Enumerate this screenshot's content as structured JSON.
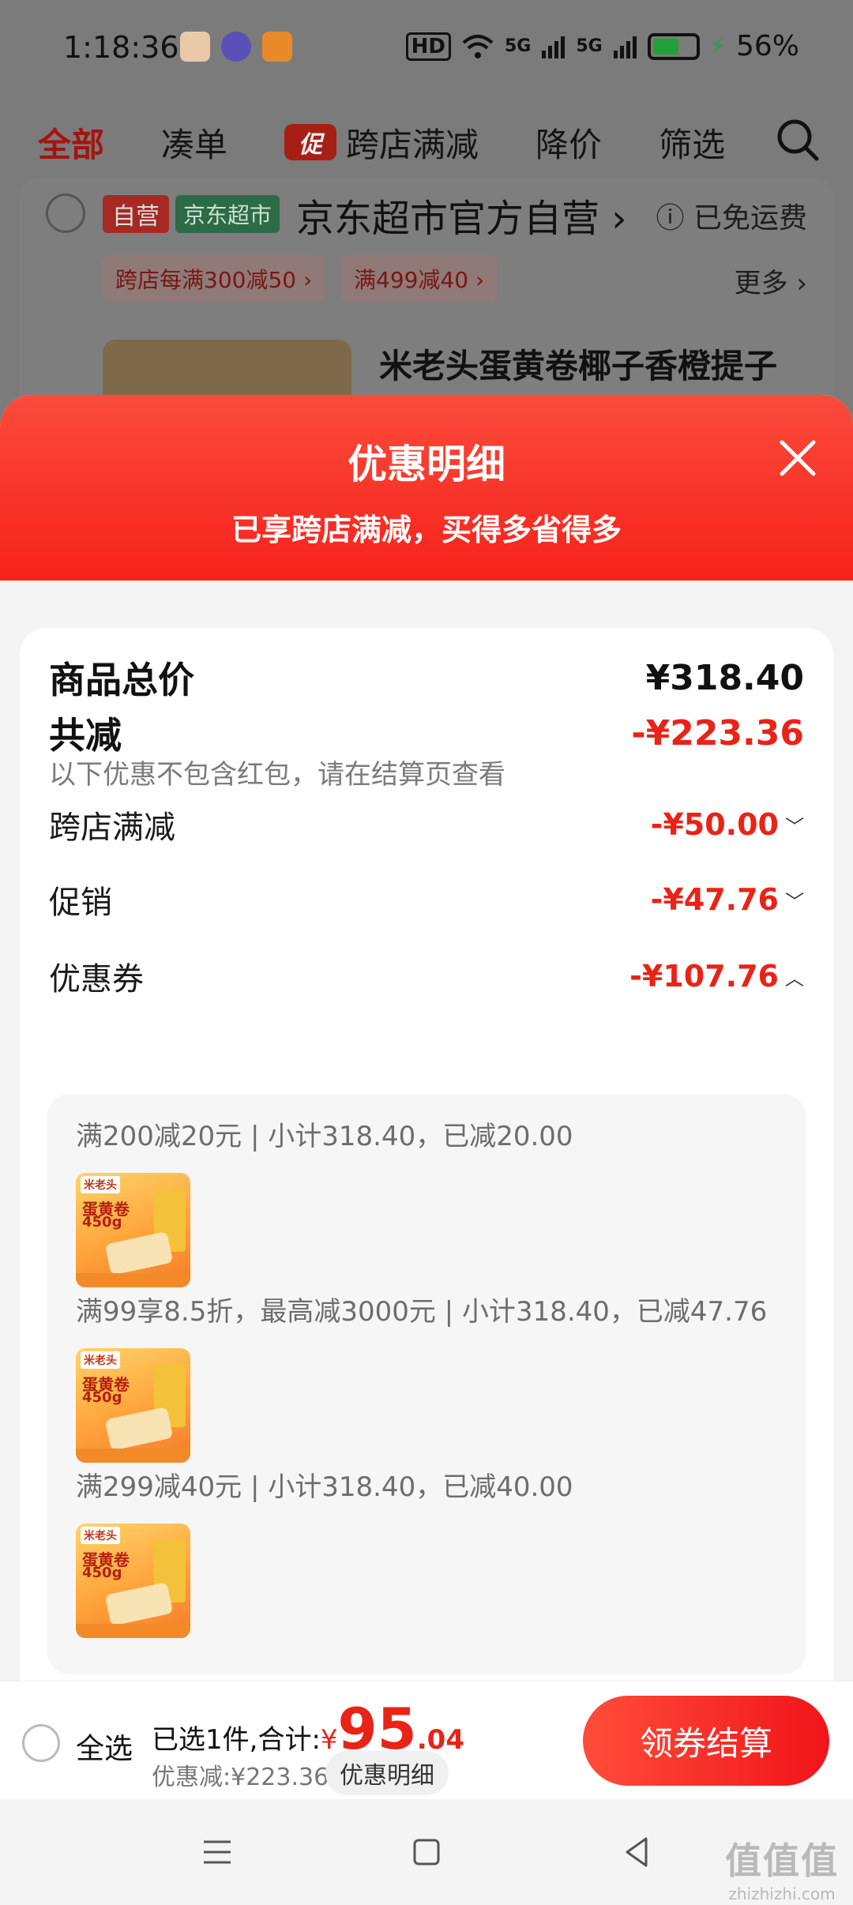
{
  "status_bar": {
    "time": "1:18:36",
    "hd_label": "HD",
    "net1": "5G",
    "net2": "5G",
    "battery": "56%"
  },
  "top_tabs": {
    "all": "全部",
    "combine": "凑单",
    "promo_badge": "促",
    "cross_store": "跨店满减",
    "price_drop": "降价",
    "filter": "筛选"
  },
  "store": {
    "tag_self": "自营",
    "tag_jd": "京东超市",
    "name": "京东超市官方自营",
    "shipping": "已免运费",
    "chip1": "跨店每满300减50",
    "chip2": "满499减40",
    "more": "更多"
  },
  "product": {
    "title": "米老头蛋黄卷椰子香橙提子"
  },
  "sheet": {
    "title": "优惠明细",
    "subtitle": "已享跨店满减，买得多省得多",
    "total_label": "商品总价",
    "total_value": "¥318.40",
    "reduce_label": "共减",
    "reduce_value": "-¥223.36",
    "note": "以下优惠不包含红包，请在结算页查看",
    "items": [
      {
        "label": "跨店满减",
        "value": "-¥50.00"
      },
      {
        "label": "促销",
        "value": "-¥47.76"
      },
      {
        "label": "优惠券",
        "value": "-¥107.76"
      }
    ],
    "coupons": [
      {
        "text": "满200减20元 | 小计318.40，已减20.00"
      },
      {
        "text": "满99享8.5折，最高减3000元 | 小计318.40，已减47.76"
      },
      {
        "text": "满299减40元 | 小计318.40，已减40.00"
      }
    ],
    "thumb_brand": "米老头",
    "thumb_text1": "蛋黄卷",
    "thumb_text2": "450g"
  },
  "bottom_bar": {
    "select_all": "全选",
    "selected_text": "已选1件,合计:",
    "currency": "¥",
    "total_int": "95",
    "total_dec": ".04",
    "discount_text": "优惠减:¥223.36",
    "detail_button": "优惠明细",
    "checkout_button": "领券结算"
  },
  "watermark": {
    "line1": "值值值",
    "line2": "zhizhizhi.com"
  },
  "colors": {
    "accent_red": "#e92317",
    "header_red": "#f6221b",
    "battery_green": "#21a13a"
  }
}
